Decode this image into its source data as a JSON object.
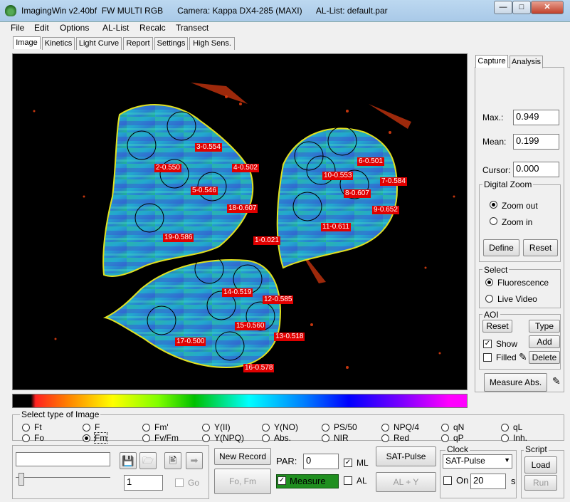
{
  "window": {
    "title": "ImagingWin v2.40bf  FW MULTI RGB      Camera: Kappa DX4-285 (MAXI)      AL-List: default.par"
  },
  "menu": [
    "File",
    "Edit",
    "Options",
    "AL-List",
    "Recalc",
    "Transect"
  ],
  "tabs": [
    "Image",
    "Kinetics",
    "Light Curve",
    "Report",
    "Settings",
    "High Sens."
  ],
  "side_tabs": [
    "Capture",
    "Analysis"
  ],
  "stats": {
    "max_label": "Max.:",
    "max": "0.949",
    "mean_label": "Mean:",
    "mean": "0.199",
    "cursor_label": "Cursor:",
    "cursor": "0.000"
  },
  "digital_zoom": {
    "title": "Digital Zoom",
    "zoom_out": "Zoom out",
    "zoom_in": "Zoom in",
    "define": "Define",
    "reset": "Reset"
  },
  "select": {
    "title": "Select",
    "fluorescence": "Fluorescence",
    "live_video": "Live Video"
  },
  "aoi": {
    "title": "AOI",
    "reset": "Reset",
    "type": "Type",
    "show": "Show",
    "add": "Add",
    "filled": "Filled",
    "delete": "Delete"
  },
  "measure_abs": "Measure Abs.",
  "aoi_labels": [
    {
      "id": "3-0.554"
    },
    {
      "id": "4-0.502"
    },
    {
      "id": "2-0.550"
    },
    {
      "id": "5-0.546"
    },
    {
      "id": "18-0.607"
    },
    {
      "id": "19-0.586"
    },
    {
      "id": "1-0.021"
    },
    {
      "id": "6-0.501"
    },
    {
      "id": "10-0.553"
    },
    {
      "id": "7-0.584"
    },
    {
      "id": "8-0.607"
    },
    {
      "id": "9-0.652"
    },
    {
      "id": "11-0.611"
    },
    {
      "id": "14-0.519"
    },
    {
      "id": "12-0.585"
    },
    {
      "id": "15-0.560"
    },
    {
      "id": "13-0.518"
    },
    {
      "id": "17-0.500"
    },
    {
      "id": "16-0.578"
    }
  ],
  "image_type": {
    "title": "Select type of Image",
    "row1": [
      "Ft",
      "F",
      "Fm'",
      "Y(II)",
      "Y(NO)",
      "PS/50",
      "NPQ/4",
      "qN",
      "qL"
    ],
    "row2": [
      "Fo",
      "Fm",
      "Fv/Fm",
      "Y(NPQ)",
      "Abs.",
      "NIR",
      "Red",
      "qP",
      "Inh."
    ],
    "selected": "Fm"
  },
  "bottom": {
    "counter": "1",
    "go": "Go",
    "new_record": "New Record",
    "fo_fm": "Fo, Fm",
    "par_label": "PAR:",
    "par_value": "0",
    "ml": "ML",
    "al": "AL",
    "measure": "Measure",
    "sat_pulse": "SAT-Pulse",
    "al_y": "AL + Y",
    "clock_title": "Clock",
    "clock_select": "SAT-Pulse",
    "on": "On",
    "interval": "20",
    "unit": "s",
    "script_title": "Script",
    "load": "Load",
    "run": "Run"
  }
}
